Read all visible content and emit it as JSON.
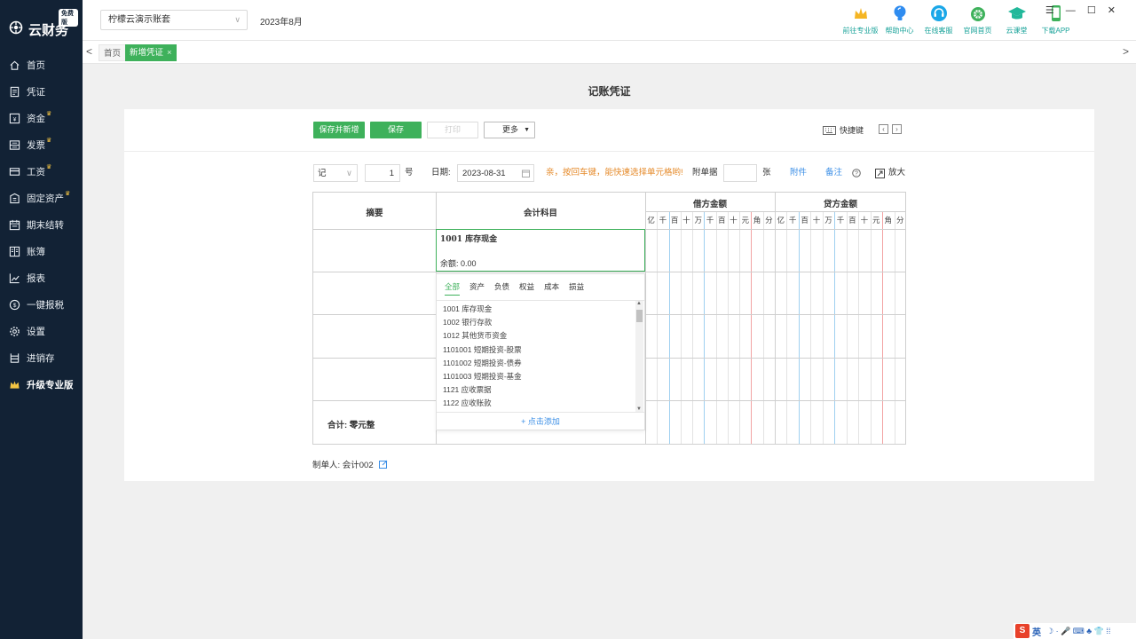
{
  "sidebar": {
    "logo_badge": "免费版",
    "logo_text": "云财务",
    "items": [
      {
        "label": "首页",
        "icon": "home-icon",
        "crown": false
      },
      {
        "label": "凭证",
        "icon": "voucher-icon",
        "crown": false
      },
      {
        "label": "资金",
        "icon": "fund-icon",
        "crown": true
      },
      {
        "label": "发票",
        "icon": "invoice-icon",
        "crown": true
      },
      {
        "label": "工资",
        "icon": "salary-icon",
        "crown": true
      },
      {
        "label": "固定资产",
        "icon": "fixed-asset-icon",
        "crown": true
      },
      {
        "label": "期末结转",
        "icon": "calendar-icon",
        "crown": false
      },
      {
        "label": "账簿",
        "icon": "ledger-icon",
        "crown": false
      },
      {
        "label": "报表",
        "icon": "report-icon",
        "crown": false
      },
      {
        "label": "一键报税",
        "icon": "tax-icon",
        "crown": false
      },
      {
        "label": "设置",
        "icon": "settings-icon",
        "crown": false
      },
      {
        "label": "进销存",
        "icon": "inventory-icon",
        "crown": false
      },
      {
        "label": "升级专业版",
        "icon": "crown-icon",
        "crown": false
      }
    ]
  },
  "topbar": {
    "account": "柠檬云演示账套",
    "period": "2023年8月",
    "tools": [
      {
        "label": "前往专业版",
        "icon": "crown-icon"
      },
      {
        "label": "帮助中心",
        "icon": "lightbulb-icon"
      },
      {
        "label": "在线客服",
        "icon": "headset-icon"
      },
      {
        "label": "官网首页",
        "icon": "lemon-icon"
      },
      {
        "label": "云课堂",
        "icon": "graduation-cap-icon"
      },
      {
        "label": "下载APP",
        "icon": "phone-icon"
      }
    ],
    "window_controls": "☰ — ☐ ✕"
  },
  "tabs": {
    "home": "首页",
    "active": "新增凭证",
    "close": "×"
  },
  "page_title": "记账凭证",
  "toolbar": {
    "save_new": "保存并新增",
    "save": "保存",
    "print": "打印",
    "more": "更多",
    "shortcut": "快捷键"
  },
  "meta": {
    "voucher_word": "记",
    "voucher_number": "1",
    "number_suffix": "号",
    "date_label": "日期:",
    "date_value": "2023-08-31",
    "hint": "亲，按回车键，能快速选择单元格哟!",
    "attach_label": "附单据",
    "attach_suffix": "张",
    "attachment_link": "附件",
    "note_link": "备注",
    "zoom": "放大"
  },
  "table": {
    "col_summary": "摘要",
    "col_subject": "会计科目",
    "col_debit": "借方金额",
    "col_credit": "贷方金额",
    "digits": [
      "亿",
      "千",
      "百",
      "十",
      "万",
      "千",
      "百",
      "十",
      "元",
      "角",
      "分"
    ],
    "active_subject": "1001 库存现金",
    "balance": "余额: 0.00",
    "total": "合计: 零元整"
  },
  "dropdown": {
    "tabs": [
      "全部",
      "资产",
      "负债",
      "权益",
      "成本",
      "损益"
    ],
    "items": [
      "1001 库存现金",
      "1002 银行存款",
      "1012 其他货币资金",
      "1101001 短期投资-股票",
      "1101002 短期投资-债券",
      "1101003 短期投资-基金",
      "1121 应收票据",
      "1122 应收账款"
    ],
    "add": "+ 点击添加"
  },
  "footer": {
    "maker": "制单人: 会计002"
  },
  "ime": {
    "logo": "S",
    "mode": "英",
    "icons": "☽ · 🎤 ⌨ ♣ 👕 ⁞⁞"
  }
}
